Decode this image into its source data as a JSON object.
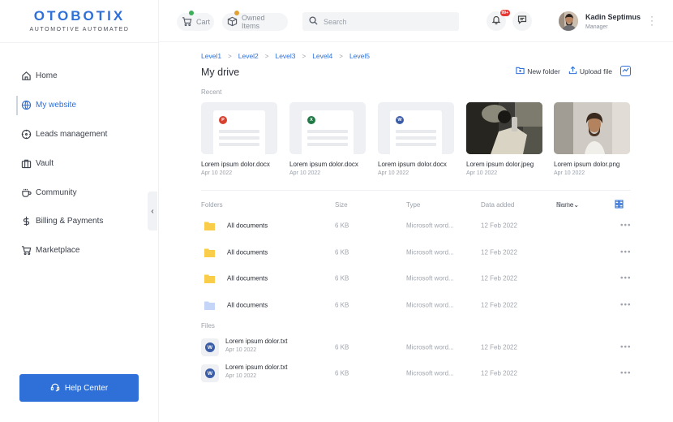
{
  "brand": {
    "title": "OTOBOTIX",
    "subtitle": "AUTOMOTIVE AUTOMATED",
    "accent": "#2e6fd8"
  },
  "sidebar": {
    "items": [
      {
        "label": "Home",
        "icon": "home-icon",
        "active": false
      },
      {
        "label": "My website",
        "icon": "globe-icon",
        "active": true
      },
      {
        "label": "Leads management",
        "icon": "target-icon",
        "active": false
      },
      {
        "label": "Vault",
        "icon": "vault-icon",
        "active": false
      },
      {
        "label": "Community",
        "icon": "cup-icon",
        "active": false
      },
      {
        "label": "Billing & Payments",
        "icon": "dollar-icon",
        "active": false
      },
      {
        "label": "Marketplace",
        "icon": "cart-icon",
        "active": false
      }
    ],
    "collapse_glyph": "‹",
    "help_label": "Help Center"
  },
  "topbar": {
    "cart_label": "Cart",
    "owned_label": "Owned Items",
    "search_placeholder": "Search",
    "notif_badge": "99+",
    "user_name": "Kadin Septimus",
    "user_role": "Manager"
  },
  "breadcrumb": [
    "Level1",
    "Level2",
    "Level3",
    "Level4",
    "Level5"
  ],
  "page_title": "My drive",
  "actions": {
    "new_folder": "New folder",
    "upload_file": "Upload file"
  },
  "recent": {
    "label": "Recent",
    "items": [
      {
        "name": "Lorem ipsum dolor.docx",
        "date": "Apr 10 2022",
        "kind": "doc",
        "tag": "P",
        "tag_color": "#d9412f"
      },
      {
        "name": "Lorem ipsum dolor.docx",
        "date": "Apr 10 2022",
        "kind": "doc",
        "tag": "X",
        "tag_color": "#1f7a45"
      },
      {
        "name": "Lorem ipsum dolor.docx",
        "date": "Apr 10 2022",
        "kind": "doc",
        "tag": "W",
        "tag_color": "#3b5da8"
      },
      {
        "name": "Lorem ipsum dolor.jpeg",
        "date": "Apr 10 2022",
        "kind": "photo-dark"
      },
      {
        "name": "Lorem ipsum dolor.png",
        "date": "Apr 10 2022",
        "kind": "photo-light"
      }
    ]
  },
  "table": {
    "columns": {
      "name": "Folders",
      "size": "Size",
      "type": "Type",
      "date": "Data added"
    },
    "sort_label": "Sort:",
    "sort_value": "Name",
    "folders": [
      {
        "name": "All documents",
        "size": "6 KB",
        "type": "Microsoft word...",
        "date": "12 Feb 2022",
        "color": "#f9cc4a"
      },
      {
        "name": "All documents",
        "size": "6 KB",
        "type": "Microsoft word...",
        "date": "12 Feb 2022",
        "color": "#f9cc4a"
      },
      {
        "name": "All documents",
        "size": "6 KB",
        "type": "Microsoft word...",
        "date": "12 Feb 2022",
        "color": "#f9cc4a"
      },
      {
        "name": "All documents",
        "size": "6 KB",
        "type": "Microsoft word...",
        "date": "12 Feb 2022",
        "color": "#c4d5f7"
      }
    ],
    "files_label": "Files",
    "files": [
      {
        "name": "Lorem ipsum dolor.txt",
        "date": "Apr 10 2022",
        "size": "6 KB",
        "type": "Microsoft word...",
        "added": "12 Feb 2022",
        "tag": "W"
      },
      {
        "name": "Lorem ipsum dolor.txt",
        "date": "Apr 10 2022",
        "size": "6 KB",
        "type": "Microsoft word...",
        "added": "12 Feb 2022",
        "tag": "W"
      }
    ],
    "more_glyph": "•••"
  }
}
